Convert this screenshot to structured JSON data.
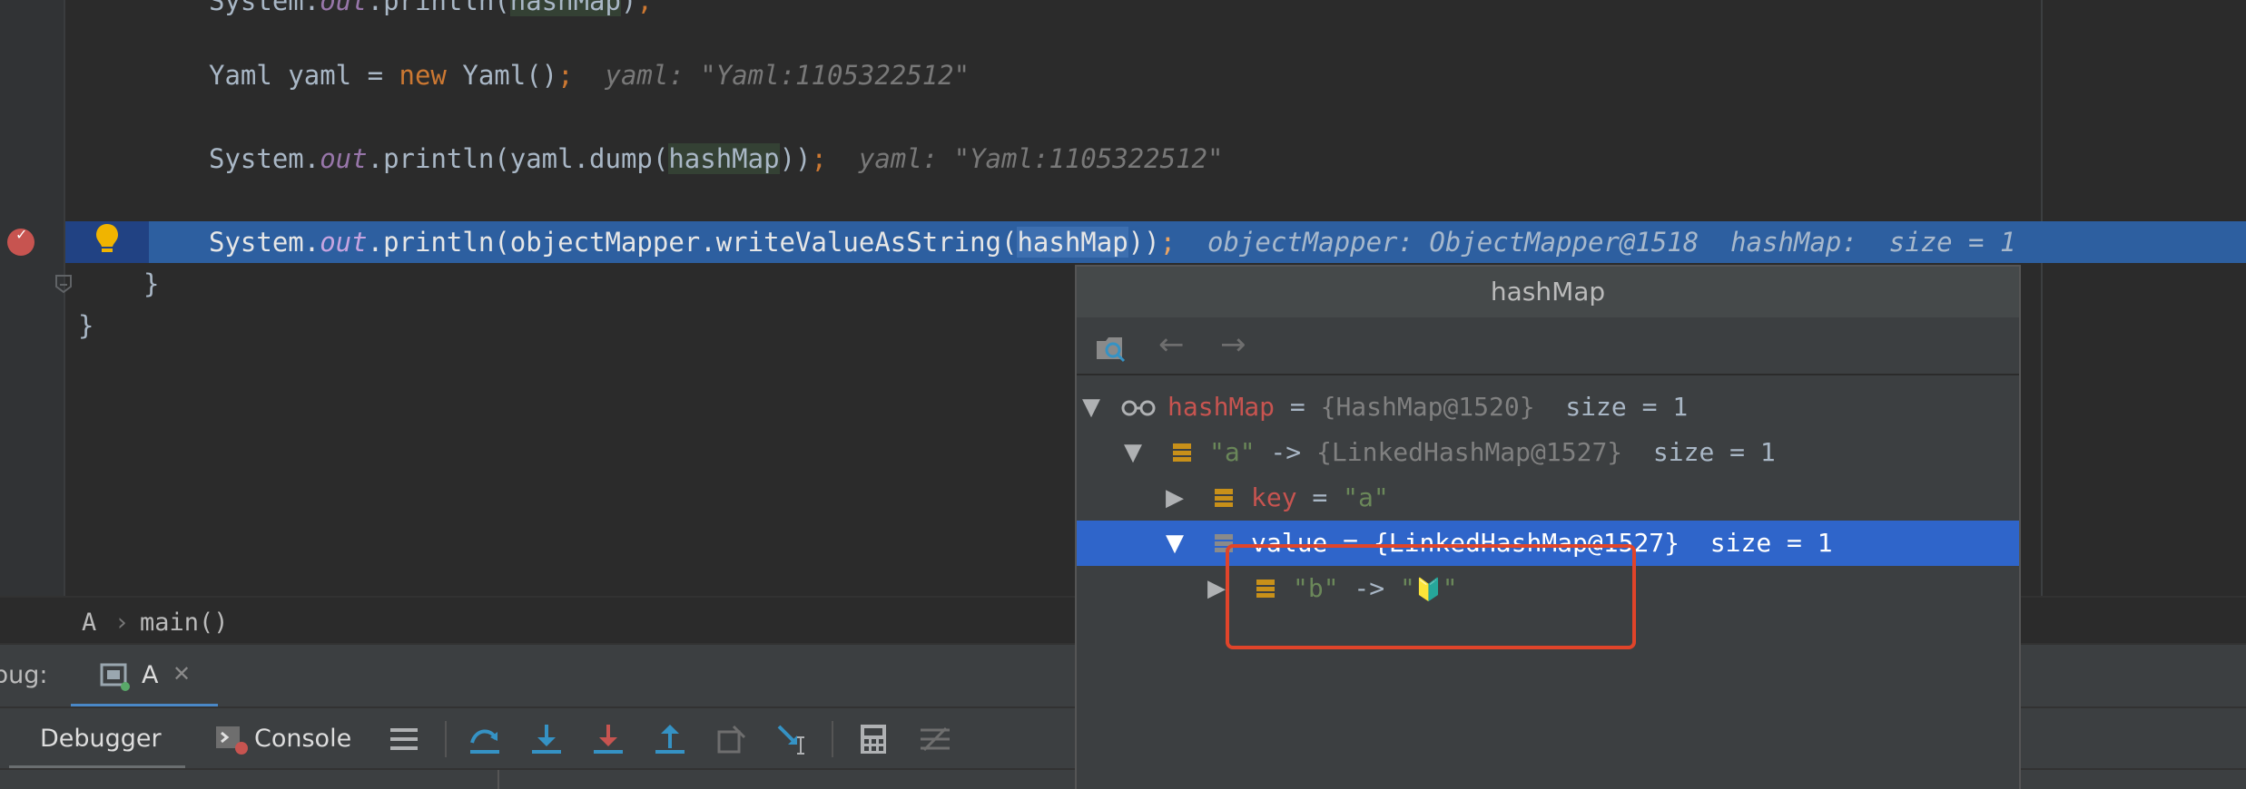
{
  "editor": {
    "lines": {
      "top_partial": {
        "prefix": "System.",
        "static": "out",
        "mid": ".println(",
        "var": "hashMap",
        "suffix": ")",
        "semi": ";"
      },
      "yaml_decl": {
        "type": "Yaml yaml = ",
        "kw": "new",
        "rest": " Yaml()",
        "semi": ";",
        "hint": "yaml: \"Yaml:1105322512\""
      },
      "yaml_dump": {
        "prefix": "System.",
        "static": "out",
        "mid": ".println(yaml.dump(",
        "var": "hashMap",
        "suffix": "))",
        "semi": ";",
        "hint": "yaml: \"Yaml:1105322512\""
      },
      "exec": {
        "prefix": "System.",
        "static": "out",
        "mid": ".println(objectMapper.writeValueAsString(",
        "var": "hashMap",
        "suffix": "))",
        "semi": ";",
        "hint": "objectMapper: ObjectMapper@1518  hashMap:  size = 1"
      },
      "close_inner": "}",
      "close_outer": "}"
    }
  },
  "breadcrumb": {
    "class_name": "A",
    "separator": "›",
    "method": "main()"
  },
  "debug": {
    "label": "bug:",
    "session_tab": "A",
    "close": "✕",
    "tabs": {
      "debugger": "Debugger",
      "console": "Console"
    }
  },
  "popup": {
    "title": "hashMap",
    "tree": [
      {
        "name": "hashMap",
        "eq": " = ",
        "obj": "{HashMap@1520}",
        "extra": "  size = 1",
        "expanded": true
      },
      {
        "key": "\"a\"",
        "arrow": " -> ",
        "obj": "{LinkedHashMap@1527}",
        "extra": "  size = 1",
        "expanded": true
      },
      {
        "name": "key",
        "eq": " = ",
        "str": "\"a\"",
        "expanded": false
      },
      {
        "name": "value",
        "eq": " = ",
        "obj": "{LinkedHashMap@1527}",
        "extra": "  size = 1",
        "expanded": true,
        "selected": true
      },
      {
        "key": "\"b\"",
        "arrow": " -> ",
        "str_open": "\"",
        "emoji": "🔰",
        "str_close": "\"",
        "expanded": false
      }
    ]
  },
  "colors": {
    "exec_line": "#2d5fa0",
    "selection": "#2f65ca",
    "highlight_box": "#e0442a",
    "breakpoint": "#c75450"
  }
}
